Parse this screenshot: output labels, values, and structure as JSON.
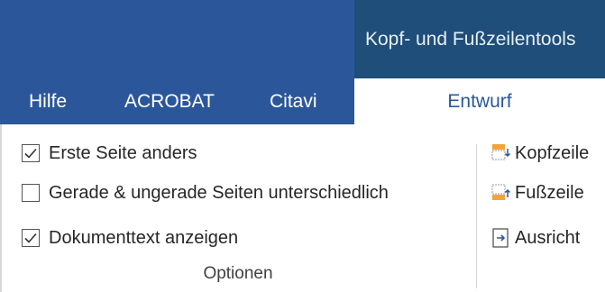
{
  "context_tab": {
    "label": "Kopf- und Fußzeilentools"
  },
  "tabs": [
    {
      "label": "Hilfe"
    },
    {
      "label": "ACROBAT"
    },
    {
      "label": "Citavi"
    }
  ],
  "active_tab": {
    "label": "Entwurf"
  },
  "options_group": {
    "items": [
      {
        "label": "Erste Seite anders",
        "checked": true
      },
      {
        "label": "Gerade & ungerade Seiten unterschiedlich",
        "checked": false
      },
      {
        "label": "Dokumenttext anzeigen",
        "checked": true
      }
    ],
    "group_label": "Optionen"
  },
  "position_group": {
    "items": [
      {
        "label": "Kopfzeile",
        "icon": "header-position-icon"
      },
      {
        "label": "Fußzeile",
        "icon": "footer-position-icon"
      },
      {
        "label": "Ausricht",
        "icon": "align-tab-icon"
      }
    ]
  },
  "colors": {
    "ribbon_blue": "#2b579a",
    "context_blue": "#1e4e79",
    "icon_orange": "#f2a533"
  }
}
